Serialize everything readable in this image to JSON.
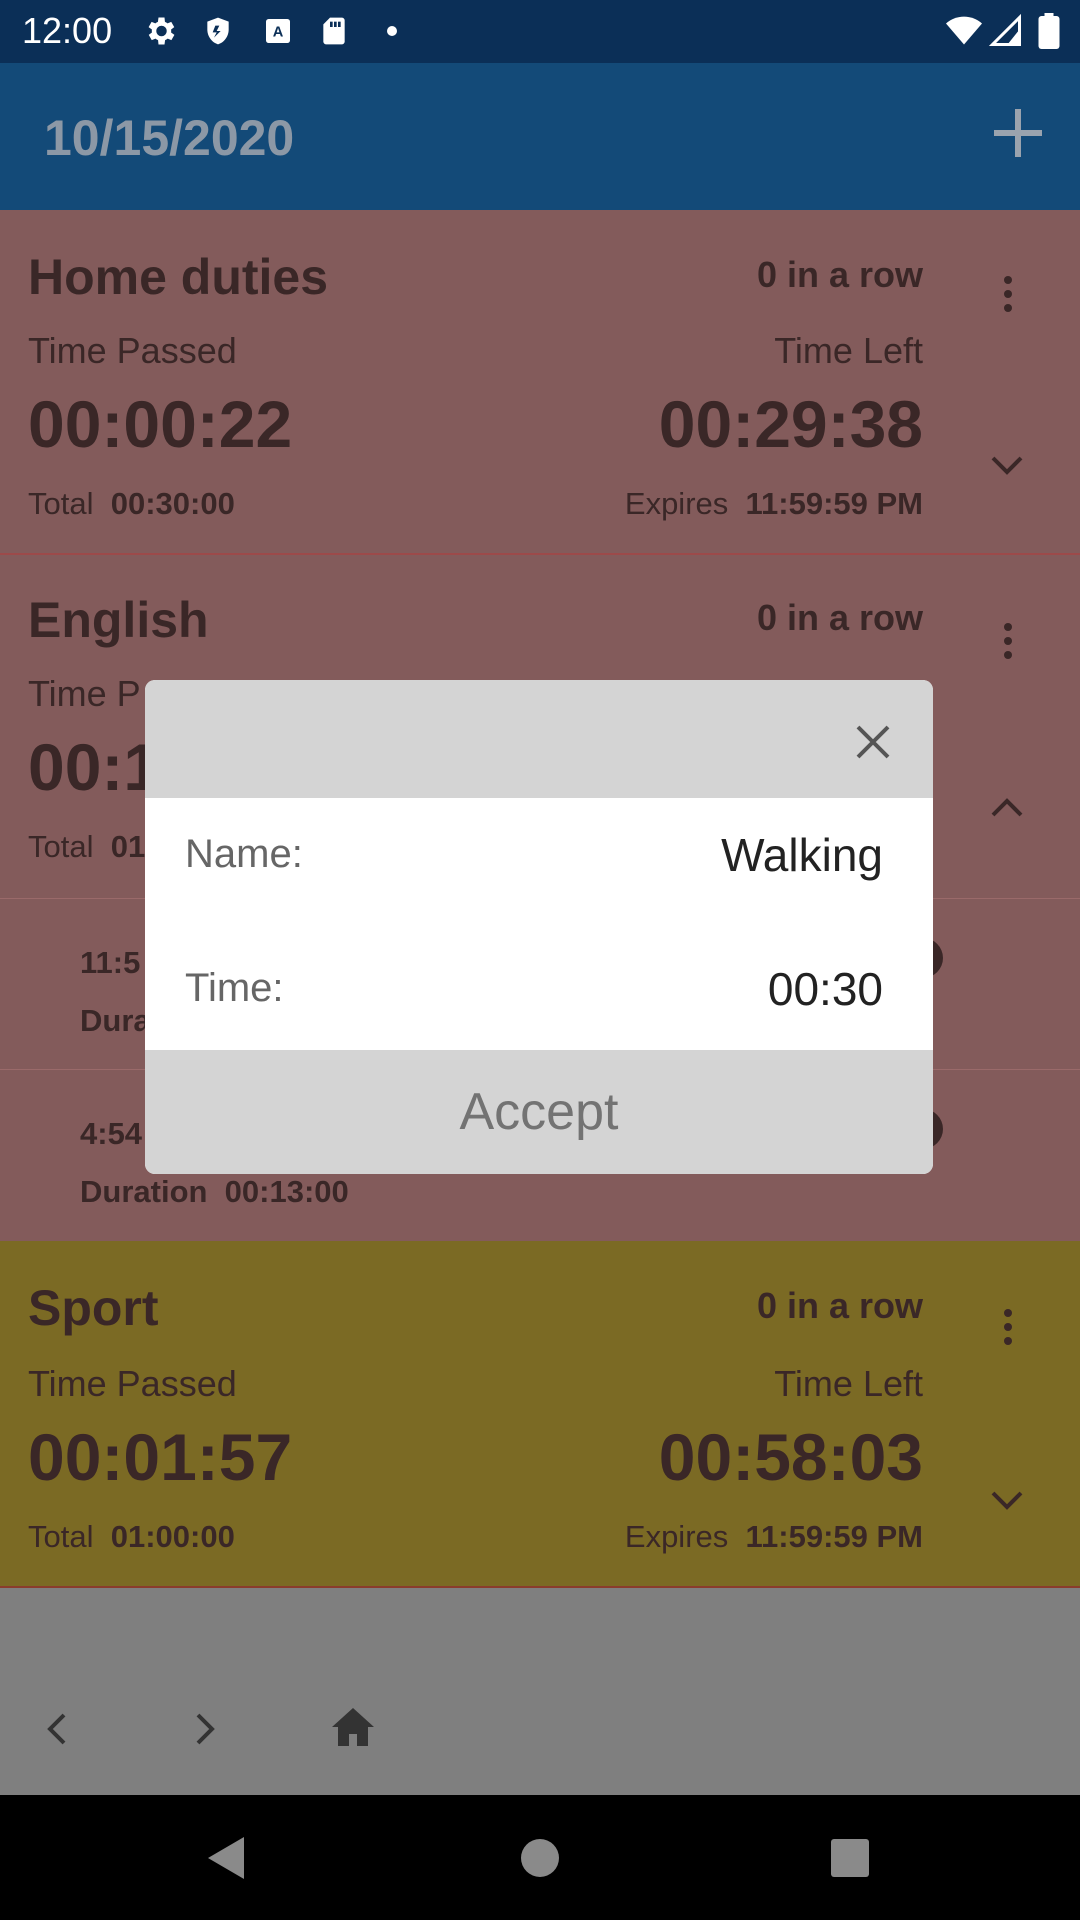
{
  "status_bar": {
    "time": "12:00",
    "icons": [
      "gear-icon",
      "shield-icon",
      "a-box-icon",
      "sd-card-icon",
      "dot-icon",
      "wifi-icon",
      "signal-icon",
      "battery-icon"
    ]
  },
  "app_bar": {
    "date": "10/15/2020",
    "add_icon": "plus-icon"
  },
  "cards": [
    {
      "title": "Home duties",
      "streak": "0  in a row",
      "passed_label": "Time Passed",
      "passed_value": "00:00:22",
      "left_label": "Time Left",
      "left_value": "00:29:38",
      "total_label": "Total",
      "total_value": "00:30:00",
      "expires_label": "Expires",
      "expires_value": "11:59:59 PM"
    },
    {
      "title": "English",
      "streak": "0  in a row",
      "passed_label_partial": "Time P",
      "passed_value_partial": "00:1",
      "total_label": "Total",
      "total_value_partial": "01",
      "entries": [
        {
          "time_partial": "11:5",
          "duration_partial": "Dura"
        },
        {
          "time_partial": "4:54",
          "duration_label": "Duration",
          "duration_value": "00:13:00"
        }
      ]
    },
    {
      "title": "Sport",
      "streak": "0  in a row",
      "passed_label": "Time Passed",
      "passed_value": "00:01:57",
      "left_label": "Time Left",
      "left_value": "00:58:03",
      "total_label": "Total",
      "total_value": "01:00:00",
      "expires_label": "Expires",
      "expires_value": "11:59:59 PM"
    }
  ],
  "dialog": {
    "name_label": "Name:",
    "name_value": "Walking",
    "time_label": "Time:",
    "time_value": "00:30",
    "accept_label": "Accept"
  },
  "colors": {
    "status_bar": "#0b2f57",
    "app_bar": "#134a78",
    "card_red": "#835b5b",
    "card_yellow": "#7b6a24",
    "dialog_header": "#d4d4d4"
  }
}
